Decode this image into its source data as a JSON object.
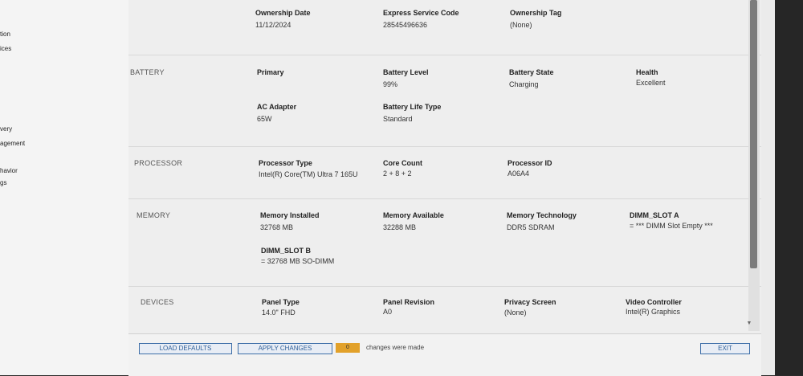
{
  "sidebar": {
    "items": [
      "tion",
      "ices",
      "very",
      "agement",
      "havior",
      "gs"
    ]
  },
  "summary": {
    "ownership_date_label": "Ownership Date",
    "ownership_date_value": "11/12/2024",
    "express_service_code_label": "Express Service Code",
    "express_service_code_value": "28545496636",
    "ownership_tag_label": "Ownership Tag",
    "ownership_tag_value": "(None)"
  },
  "battery": {
    "title": "BATTERY",
    "primary_label": "Primary",
    "battery_level_label": "Battery Level",
    "battery_level_value": "99%",
    "battery_state_label": "Battery State",
    "battery_state_value": "Charging",
    "health_label": "Health",
    "health_value": "Excellent",
    "ac_adapter_label": "AC Adapter",
    "ac_adapter_value": "65W",
    "battery_life_type_label": "Battery Life Type",
    "battery_life_type_value": "Standard"
  },
  "processor": {
    "title": "PROCESSOR",
    "type_label": "Processor Type",
    "type_value": "Intel(R) Core(TM) Ultra 7 165U",
    "core_count_label": "Core Count",
    "core_count_value": "2 + 8 + 2",
    "id_label": "Processor ID",
    "id_value": "A06A4"
  },
  "memory": {
    "title": "MEMORY",
    "installed_label": "Memory Installed",
    "installed_value": "32768 MB",
    "available_label": "Memory Available",
    "available_value": "32288 MB",
    "technology_label": "Memory Technology",
    "technology_value": "DDR5 SDRAM",
    "dimm_a_label": "DIMM_SLOT A",
    "dimm_a_value": "= *** DIMM Slot Empty ***",
    "dimm_b_label": "DIMM_SLOT B",
    "dimm_b_value": "= 32768 MB SO-DIMM"
  },
  "devices": {
    "title": "DEVICES",
    "panel_type_label": "Panel Type",
    "panel_type_value": "14.0\" FHD",
    "panel_revision_label": "Panel Revision",
    "panel_revision_value": "A0",
    "privacy_screen_label": "Privacy Screen",
    "privacy_screen_value": "(None)",
    "video_controller_label": "Video Controller",
    "video_controller_value": "Intel(R) Graphics"
  },
  "footer": {
    "load_defaults_label": "LOAD DEFAULTS",
    "apply_changes_label": "APPLY CHANGES",
    "changes_count": "0",
    "changes_text": "changes were made",
    "exit_label": "EXIT"
  },
  "colors": {
    "button_border": "#3f6fa8",
    "badge": "#e2a12a"
  },
  "icons": {
    "scroll_down": "chevron-down-icon"
  }
}
